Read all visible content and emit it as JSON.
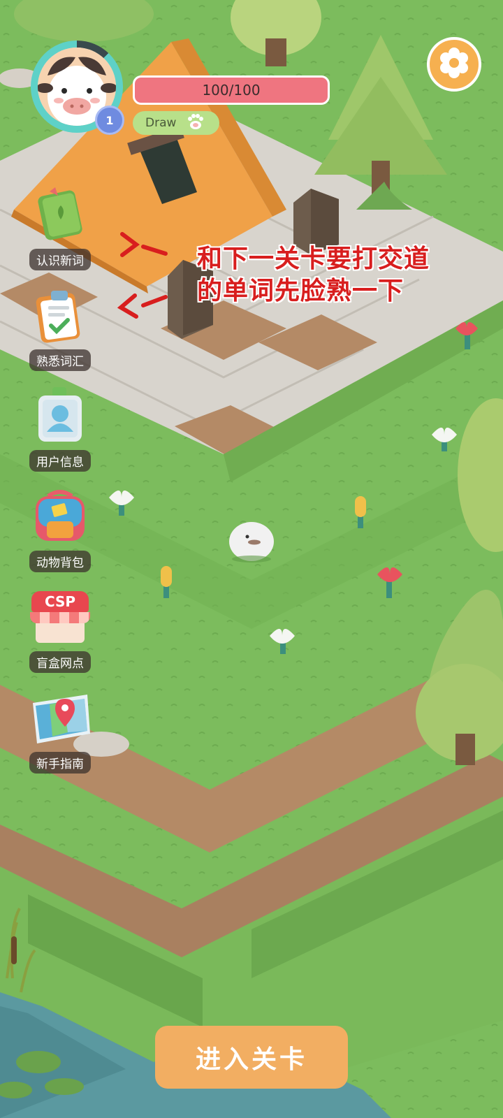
{
  "hud": {
    "hp_text": "100/100",
    "level": "1",
    "draw_label": "Draw"
  },
  "menu": [
    {
      "label": "认识新词",
      "icon": "book-icon"
    },
    {
      "label": "熟悉词汇",
      "icon": "clipboard-check-icon"
    },
    {
      "label": "用户信息",
      "icon": "user-badge-icon"
    },
    {
      "label": "动物背包",
      "icon": "backpack-icon"
    },
    {
      "label": "盲盒网点",
      "icon": "csp-shop-icon"
    },
    {
      "label": "新手指南",
      "icon": "map-pin-icon"
    }
  ],
  "shop_sign": "CSP",
  "annotation": {
    "line1": "和下一关卡要打交道",
    "line2": "的单词先脸熟一下",
    "arrow": "<—"
  },
  "enter_button": "进入关卡",
  "colors": {
    "grass": "#79b85a",
    "path": "#b48a66",
    "stone": "#d8d4cd",
    "accent_orange": "#f2ae62",
    "hp_red": "#ef7580",
    "annotation_red": "#d81e1e"
  }
}
